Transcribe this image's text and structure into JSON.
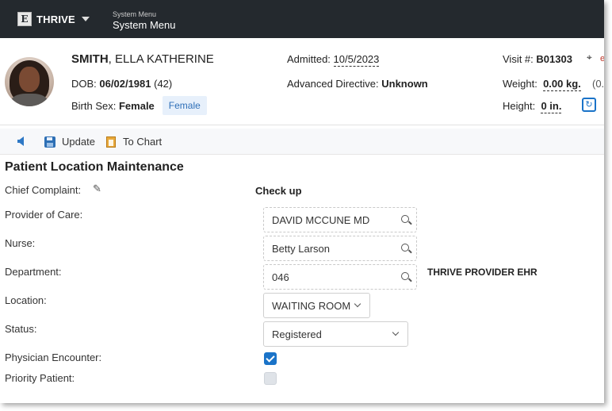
{
  "topbar": {
    "brand_logo": "E",
    "brand_name": "THRIVE",
    "system_menu_small": "System Menu",
    "system_menu": "System Menu"
  },
  "patient": {
    "last_name": "SMITH",
    "first_names": ", ELLA KATHERINE",
    "dob_label": "DOB:",
    "dob": "06/02/1981",
    "age": "(42)",
    "birth_sex_label": "Birth Sex:",
    "birth_sex": "Female",
    "gender_badge": "Female",
    "admitted_label": "Admitted:",
    "admitted": "10/5/2023",
    "adv_directive_label": "Advanced Directive:",
    "adv_directive": "Unknown",
    "visit_label": "Visit #:",
    "visit": "B01303",
    "weight_label": "Weight:",
    "weight": "0.00 kg.",
    "weight_extra": "(0.",
    "height_label": "Height:",
    "height": "0 in.",
    "loc_extra": "e"
  },
  "toolbar": {
    "update_label": "Update",
    "chart_label": "To Chart"
  },
  "form": {
    "title": "Patient Location Maintenance",
    "chief_complaint_label": "Chief Complaint:",
    "chief_complaint": "Check up",
    "provider_label": "Provider of Care:",
    "provider": "DAVID MCCUNE MD",
    "nurse_label": "Nurse:",
    "nurse": "Betty Larson",
    "department_label": "Department:",
    "department": "046",
    "department_name": "THRIVE PROVIDER EHR",
    "location_label": "Location:",
    "location": "WAITING ROOM",
    "status_label": "Status:",
    "status": "Registered",
    "physician_encounter_label": "Physician Encounter:",
    "physician_encounter": true,
    "priority_patient_label": "Priority Patient:",
    "priority_patient": false
  }
}
